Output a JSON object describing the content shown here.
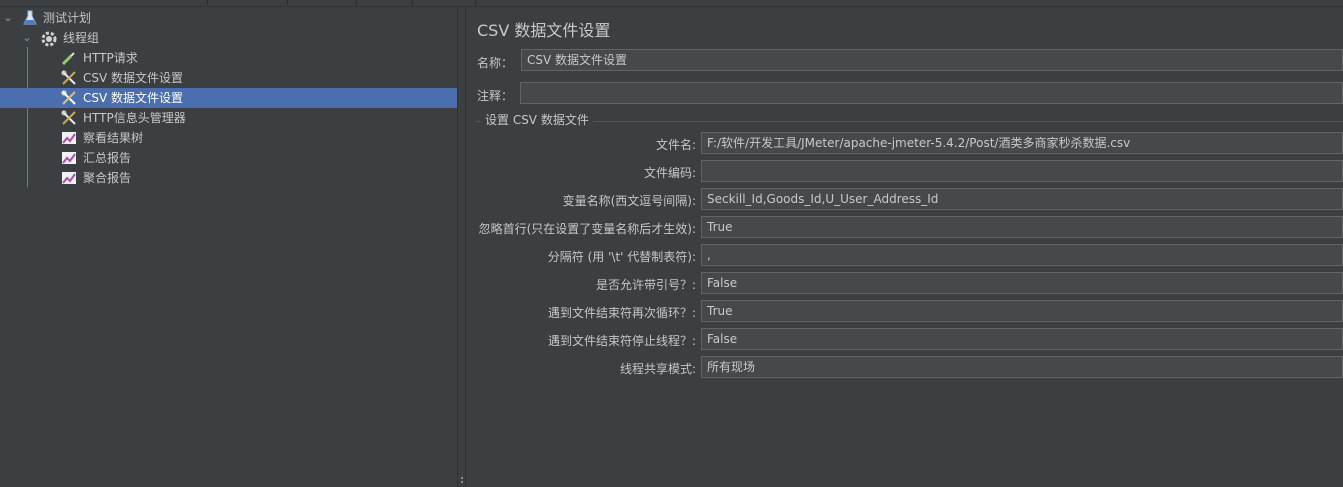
{
  "tree": {
    "items": [
      {
        "label": "测试计划",
        "icon": "flask-icon"
      },
      {
        "label": "线程组",
        "icon": "gear-icon"
      },
      {
        "label": "HTTP请求",
        "icon": "pipette-icon"
      },
      {
        "label": "CSV 数据文件设置",
        "icon": "wrench-scissors-icon"
      },
      {
        "label": "CSV 数据文件设置",
        "icon": "wrench-scissors-icon"
      },
      {
        "label": "HTTP信息头管理器",
        "icon": "wrench-scissors-icon"
      },
      {
        "label": "察看结果树",
        "icon": "graph-icon"
      },
      {
        "label": "汇总报告",
        "icon": "graph-icon"
      },
      {
        "label": "聚合报告",
        "icon": "graph-icon"
      }
    ],
    "selected_index": 4
  },
  "panel": {
    "title": "CSV 数据文件设置",
    "name_label": "名称：",
    "name_value": "CSV 数据文件设置",
    "comment_label": "注释：",
    "comment_value": "",
    "section_title": "设置 CSV 数据文件",
    "fields": [
      {
        "label": "文件名:",
        "value": "F:/软件/开发工具/JMeter/apache-jmeter-5.4.2/Post/酒类多商家秒杀数据.csv"
      },
      {
        "label": "文件编码:",
        "value": ""
      },
      {
        "label": "变量名称(西文逗号间隔):",
        "value": "Seckill_Id,Goods_Id,U_User_Address_Id"
      },
      {
        "label": "忽略首行(只在设置了变量名称后才生效):",
        "value": "True"
      },
      {
        "label": "分隔符 (用 '\\t' 代替制表符):",
        "value": ","
      },
      {
        "label": "是否允许带引号？:",
        "value": "False"
      },
      {
        "label": "遇到文件结束符再次循环？:",
        "value": "True"
      },
      {
        "label": "遇到文件结束符停止线程？:",
        "value": "False"
      },
      {
        "label": "线程共享模式:",
        "value": "所有现场"
      }
    ]
  },
  "colors": {
    "background": "#3c3f41",
    "selection": "#4b6eaf",
    "field_bg": "#45494a"
  }
}
